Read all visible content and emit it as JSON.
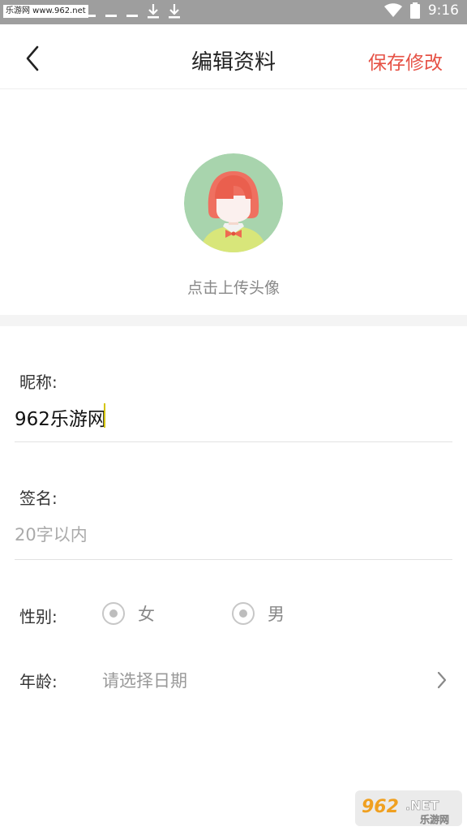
{
  "status_bar": {
    "site_badge": "乐游网 www.962.net",
    "time": "9:16",
    "icons": [
      "sim-icon",
      "sim-icon",
      "sim-icon",
      "download-icon",
      "download-icon",
      "wifi-icon",
      "battery-icon"
    ]
  },
  "header": {
    "back_icon": "chevron-left-icon",
    "title": "编辑资料",
    "save_label": "保存修改"
  },
  "avatar": {
    "hint": "点击上传头像"
  },
  "form": {
    "nickname": {
      "label": "昵称:",
      "value": "962乐游网"
    },
    "signature": {
      "label": "签名:",
      "placeholder": "20字以内",
      "value": ""
    },
    "gender": {
      "label": "性别:",
      "options": [
        "女",
        "男"
      ]
    },
    "age": {
      "label": "年龄:",
      "placeholder": "请选择日期",
      "chevron_icon": "chevron-right-icon"
    }
  },
  "watermark": {
    "brand": "962",
    "suffix": ".NET",
    "sub": "乐游网"
  },
  "colors": {
    "accent": "#e65246",
    "status_bar": "#9e9e9e",
    "avatar_bg": "#a8d4ad"
  }
}
